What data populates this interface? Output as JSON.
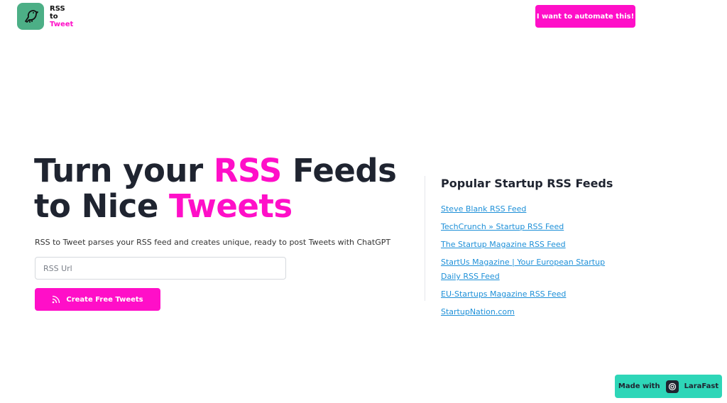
{
  "header": {
    "logo_line1": "RSS",
    "logo_line2": "to",
    "logo_line3": "Tweet",
    "automate_button": "I want to automate this!"
  },
  "hero": {
    "headline_part1": "Turn your ",
    "headline_highlight1": "RSS",
    "headline_part2": " Feeds",
    "headline_part3": "to Nice ",
    "headline_highlight2": "Tweets",
    "subtitle": "RSS to Tweet parses your RSS feed and creates unique, ready to post Tweets with ChatGPT",
    "input_placeholder": "RSS Url",
    "create_button": "Create Free Tweets"
  },
  "feeds": {
    "title": "Popular Startup RSS Feeds",
    "items": [
      {
        "label": "Steve Blank RSS Feed"
      },
      {
        "label": "TechCrunch » Startup RSS Feed"
      },
      {
        "label": "The Startup Magazine RSS Feed"
      },
      {
        "label": "StartUs Magazine | Your European Startup Daily RSS Feed"
      },
      {
        "label": "EU-Startups Magazine RSS Feed"
      },
      {
        "label": "StartupNation.com"
      }
    ]
  },
  "footer_badge": {
    "made_with": "Made with",
    "brand": "LaraFast"
  },
  "colors": {
    "accent_pink": "#ff0fc8",
    "logo_green": "#4caf86",
    "badge_teal": "#2ed6b8",
    "link_blue": "#1e90d8"
  },
  "icons": {
    "logo": "bird-icon",
    "create_button": "rss-icon",
    "badge": "larafast-logo-icon"
  }
}
